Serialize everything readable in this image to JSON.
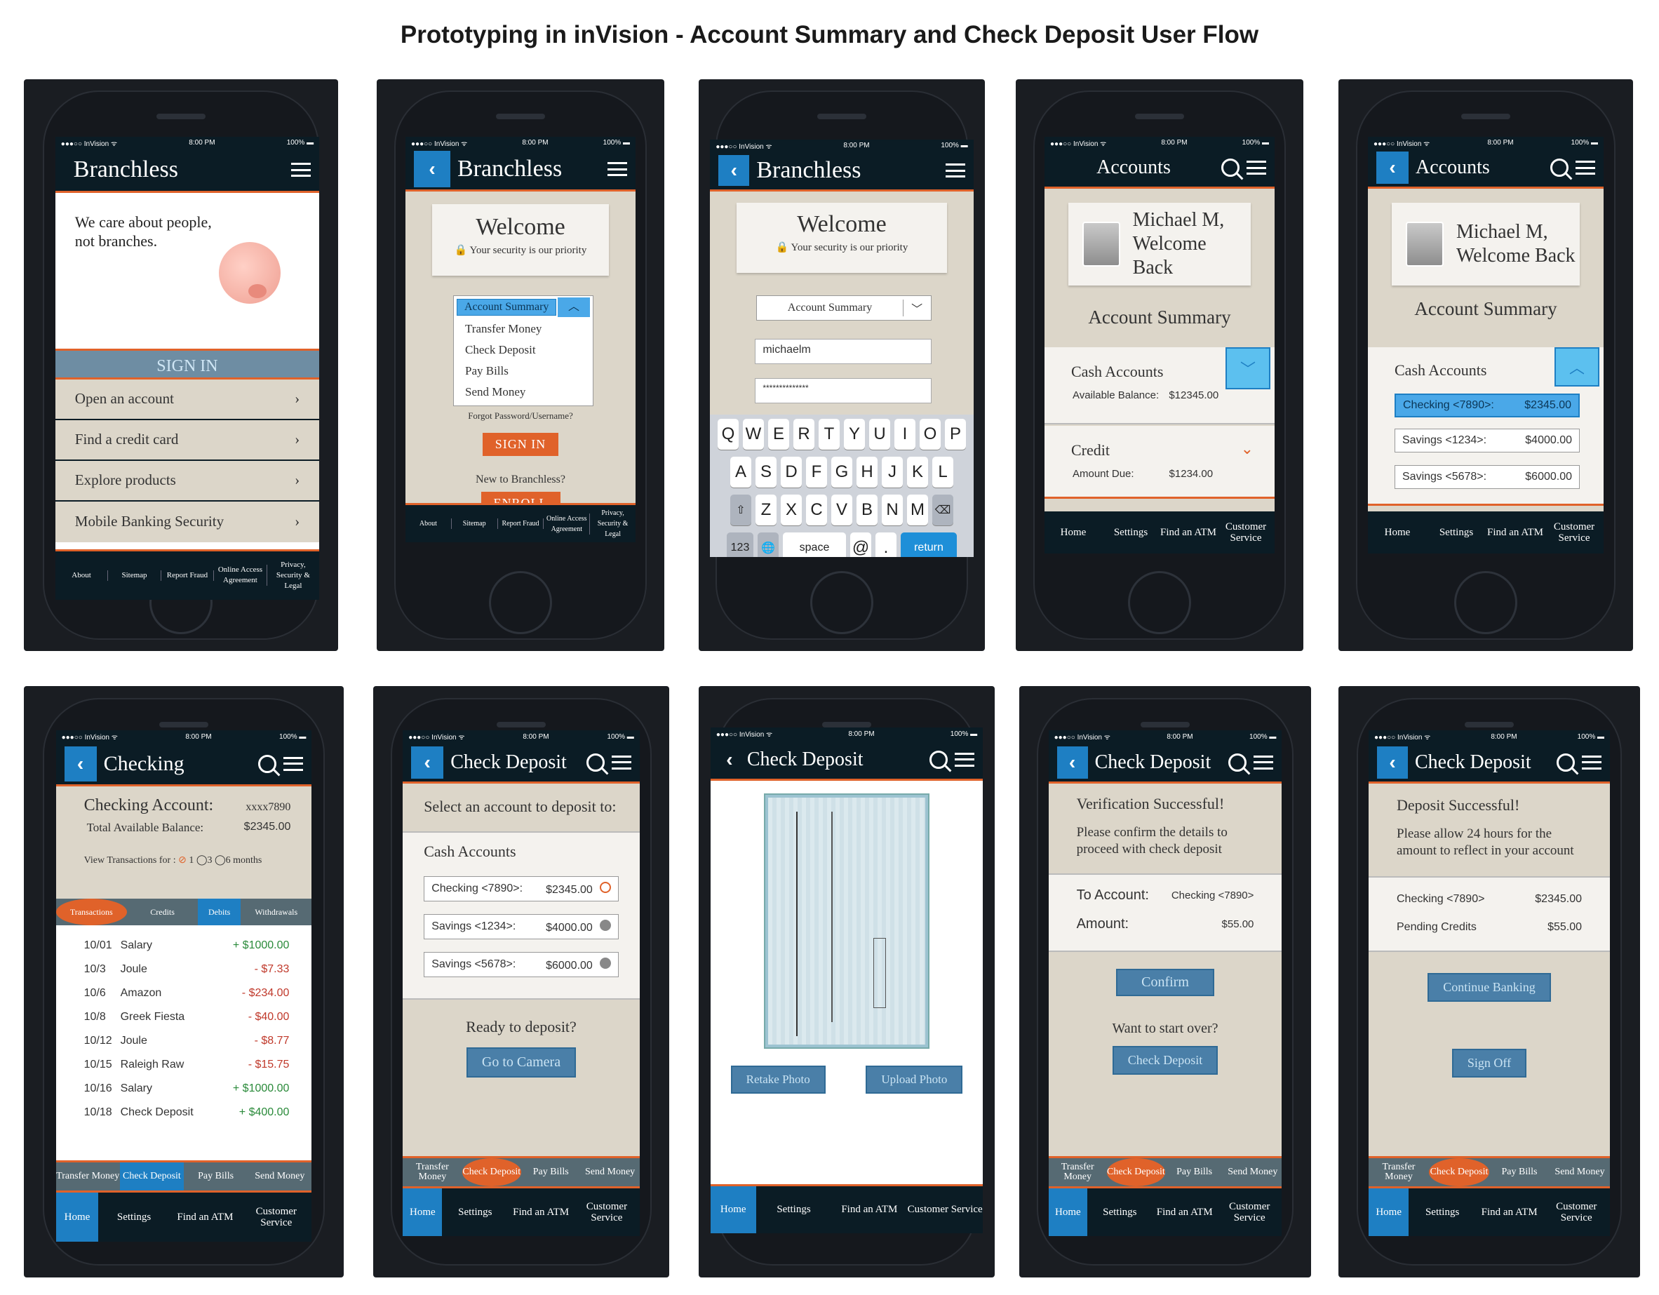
{
  "page_title": "Prototyping in inVision - Account Summary and Check Deposit User Flow",
  "status": {
    "carrier": "●●●○○ InVision ᯤ",
    "time": "8:00 PM",
    "battery": "100% ▬"
  },
  "screens": {
    "s1": {
      "nav_title": "Branchless",
      "tagline_line1": "We care about people,",
      "tagline_line2": "not branches.",
      "signin": "SIGN IN",
      "items": [
        "Open an account",
        "Find a credit card",
        "Explore products",
        "Mobile Banking Security"
      ],
      "footer": [
        "About",
        "Sitemap",
        "Report Fraud",
        "Online Access Agreement",
        "Privacy, Security & Legal"
      ]
    },
    "s2": {
      "nav_title": "Branchless",
      "welcome": "Welcome",
      "security": "Your security is our priority",
      "dropdown_selected": "Account Summary",
      "dropdown_options": [
        "Transfer Money",
        "Check Deposit",
        "Pay Bills",
        "Send Money"
      ],
      "forgot": "Forgot Password/Username?",
      "signin": "SIGN IN",
      "new": "New to Branchless?",
      "enroll": "ENROLL",
      "footer": [
        "About",
        "Sitemap",
        "Report Fraud",
        "Online Access Agreement",
        "Privacy, Security & Legal"
      ]
    },
    "s3": {
      "nav_title": "Branchless",
      "welcome": "Welcome",
      "security": "Your security is our priority",
      "dropdown_selected": "Account Summary",
      "username": "michaelm",
      "password": "**************",
      "kb_row1": [
        "Q",
        "W",
        "E",
        "R",
        "T",
        "Y",
        "U",
        "I",
        "O",
        "P"
      ],
      "kb_row2": [
        "A",
        "S",
        "D",
        "F",
        "G",
        "H",
        "J",
        "K",
        "L"
      ],
      "kb_row3": [
        "Z",
        "X",
        "C",
        "V",
        "B",
        "N",
        "M"
      ],
      "kb_num": "123",
      "kb_space": "space",
      "kb_at": "@",
      "kb_dot": ".",
      "kb_return": "return"
    },
    "s4": {
      "nav_title": "Accounts",
      "greeting1": "Michael M,",
      "greeting2": "Welcome Back",
      "summary": "Account Summary",
      "cash": "Cash Accounts",
      "avail_label": "Available Balance:",
      "avail_value": "$12345.00",
      "credit": "Credit",
      "due_label": "Amount Due:",
      "due_value": "$1234.00",
      "tabs": [
        "Home",
        "Settings",
        "Find an ATM",
        "Customer Service"
      ]
    },
    "s5": {
      "nav_title": "Accounts",
      "greeting1": "Michael M,",
      "greeting2": "Welcome Back",
      "summary": "Account Summary",
      "cash": "Cash Accounts",
      "accounts": [
        {
          "name": "Checking <7890>:",
          "amount": "$2345.00"
        },
        {
          "name": "Savings <1234>:",
          "amount": "$4000.00"
        },
        {
          "name": "Savings <5678>:",
          "amount": "$6000.00"
        }
      ],
      "tabs": [
        "Home",
        "Settings",
        "Find an ATM",
        "Customer Service"
      ]
    },
    "s6": {
      "nav_title": "Checking",
      "acct_label": "Checking Account:",
      "acct_num": "xxxx7890",
      "bal_label": "Total Available Balance:",
      "bal_value": "$2345.00",
      "view_label": "View Transactions for :",
      "view_opts": [
        "1",
        "3",
        "6",
        "months"
      ],
      "filters": [
        "Transactions",
        "Credits",
        "Debits",
        "Withdrawals"
      ],
      "tx": [
        {
          "d": "10/01",
          "n": "Salary",
          "a": "+ $1000.00"
        },
        {
          "d": "10/3",
          "n": "Joule",
          "a": "- $7.33"
        },
        {
          "d": "10/6",
          "n": "Amazon",
          "a": "- $234.00"
        },
        {
          "d": "10/8",
          "n": "Greek Fiesta",
          "a": "- $40.00"
        },
        {
          "d": "10/12",
          "n": "Joule",
          "a": "- $8.77"
        },
        {
          "d": "10/15",
          "n": "Raleigh Raw",
          "a": "- $15.75"
        },
        {
          "d": "10/16",
          "n": "Salary",
          "a": "+ $1000.00"
        },
        {
          "d": "10/18",
          "n": "Check Deposit",
          "a": "+ $400.00"
        }
      ],
      "subtabs": [
        "Transfer Money",
        "Check Deposit",
        "Pay Bills",
        "Send Money"
      ],
      "tabs": [
        "Home",
        "Settings",
        "Find an ATM",
        "Customer Service"
      ]
    },
    "s7": {
      "nav_title": "Check Deposit",
      "prompt": "Select an account to deposit to:",
      "cash": "Cash Accounts",
      "accounts": [
        {
          "name": "Checking <7890>:",
          "amount": "$2345.00"
        },
        {
          "name": "Savings <1234>:",
          "amount": "$4000.00"
        },
        {
          "name": "Savings <5678>:",
          "amount": "$6000.00"
        }
      ],
      "ready": "Ready to deposit?",
      "camera": "Go to Camera",
      "subtabs": [
        "Transfer Money",
        "Check Deposit",
        "Pay Bills",
        "Send Money"
      ],
      "tabs": [
        "Home",
        "Settings",
        "Find an ATM",
        "Customer Service"
      ]
    },
    "s8": {
      "nav_title": "Check Deposit",
      "retake": "Retake Photo",
      "upload": "Upload Photo",
      "tabs": [
        "Home",
        "Settings",
        "Find an ATM",
        "Customer Service"
      ]
    },
    "s9": {
      "nav_title": "Check Deposit",
      "heading": "Verification Successful!",
      "msg": "Please confirm the details to proceed with check deposit",
      "to_label": "To Account:",
      "to_value": "Checking <7890>",
      "amt_label": "Amount:",
      "amt_value": "$55.00",
      "confirm": "Confirm",
      "start_over": "Want to start over?",
      "check_deposit": "Check Deposit",
      "subtabs": [
        "Transfer Money",
        "Check Deposit",
        "Pay Bills",
        "Send Money"
      ],
      "tabs": [
        "Home",
        "Settings",
        "Find an ATM",
        "Customer Service"
      ]
    },
    "s10": {
      "nav_title": "Check Deposit",
      "heading": "Deposit Successful!",
      "msg": "Please allow 24 hours for the amount to reflect in your account",
      "checking_label": "Checking <7890>",
      "checking_value": "$2345.00",
      "pending_label": "Pending Credits",
      "pending_value": "$55.00",
      "continue": "Continue Banking",
      "signoff": "Sign Off",
      "subtabs": [
        "Transfer Money",
        "Check Deposit",
        "Pay Bills",
        "Send Money"
      ],
      "tabs": [
        "Home",
        "Settings",
        "Find an ATM",
        "Customer Service"
      ]
    }
  },
  "colors": {
    "nav": "#0b1c25",
    "accent": "#e0622a",
    "blue": "#1e7fc3",
    "beige": "#dcd6c9"
  }
}
